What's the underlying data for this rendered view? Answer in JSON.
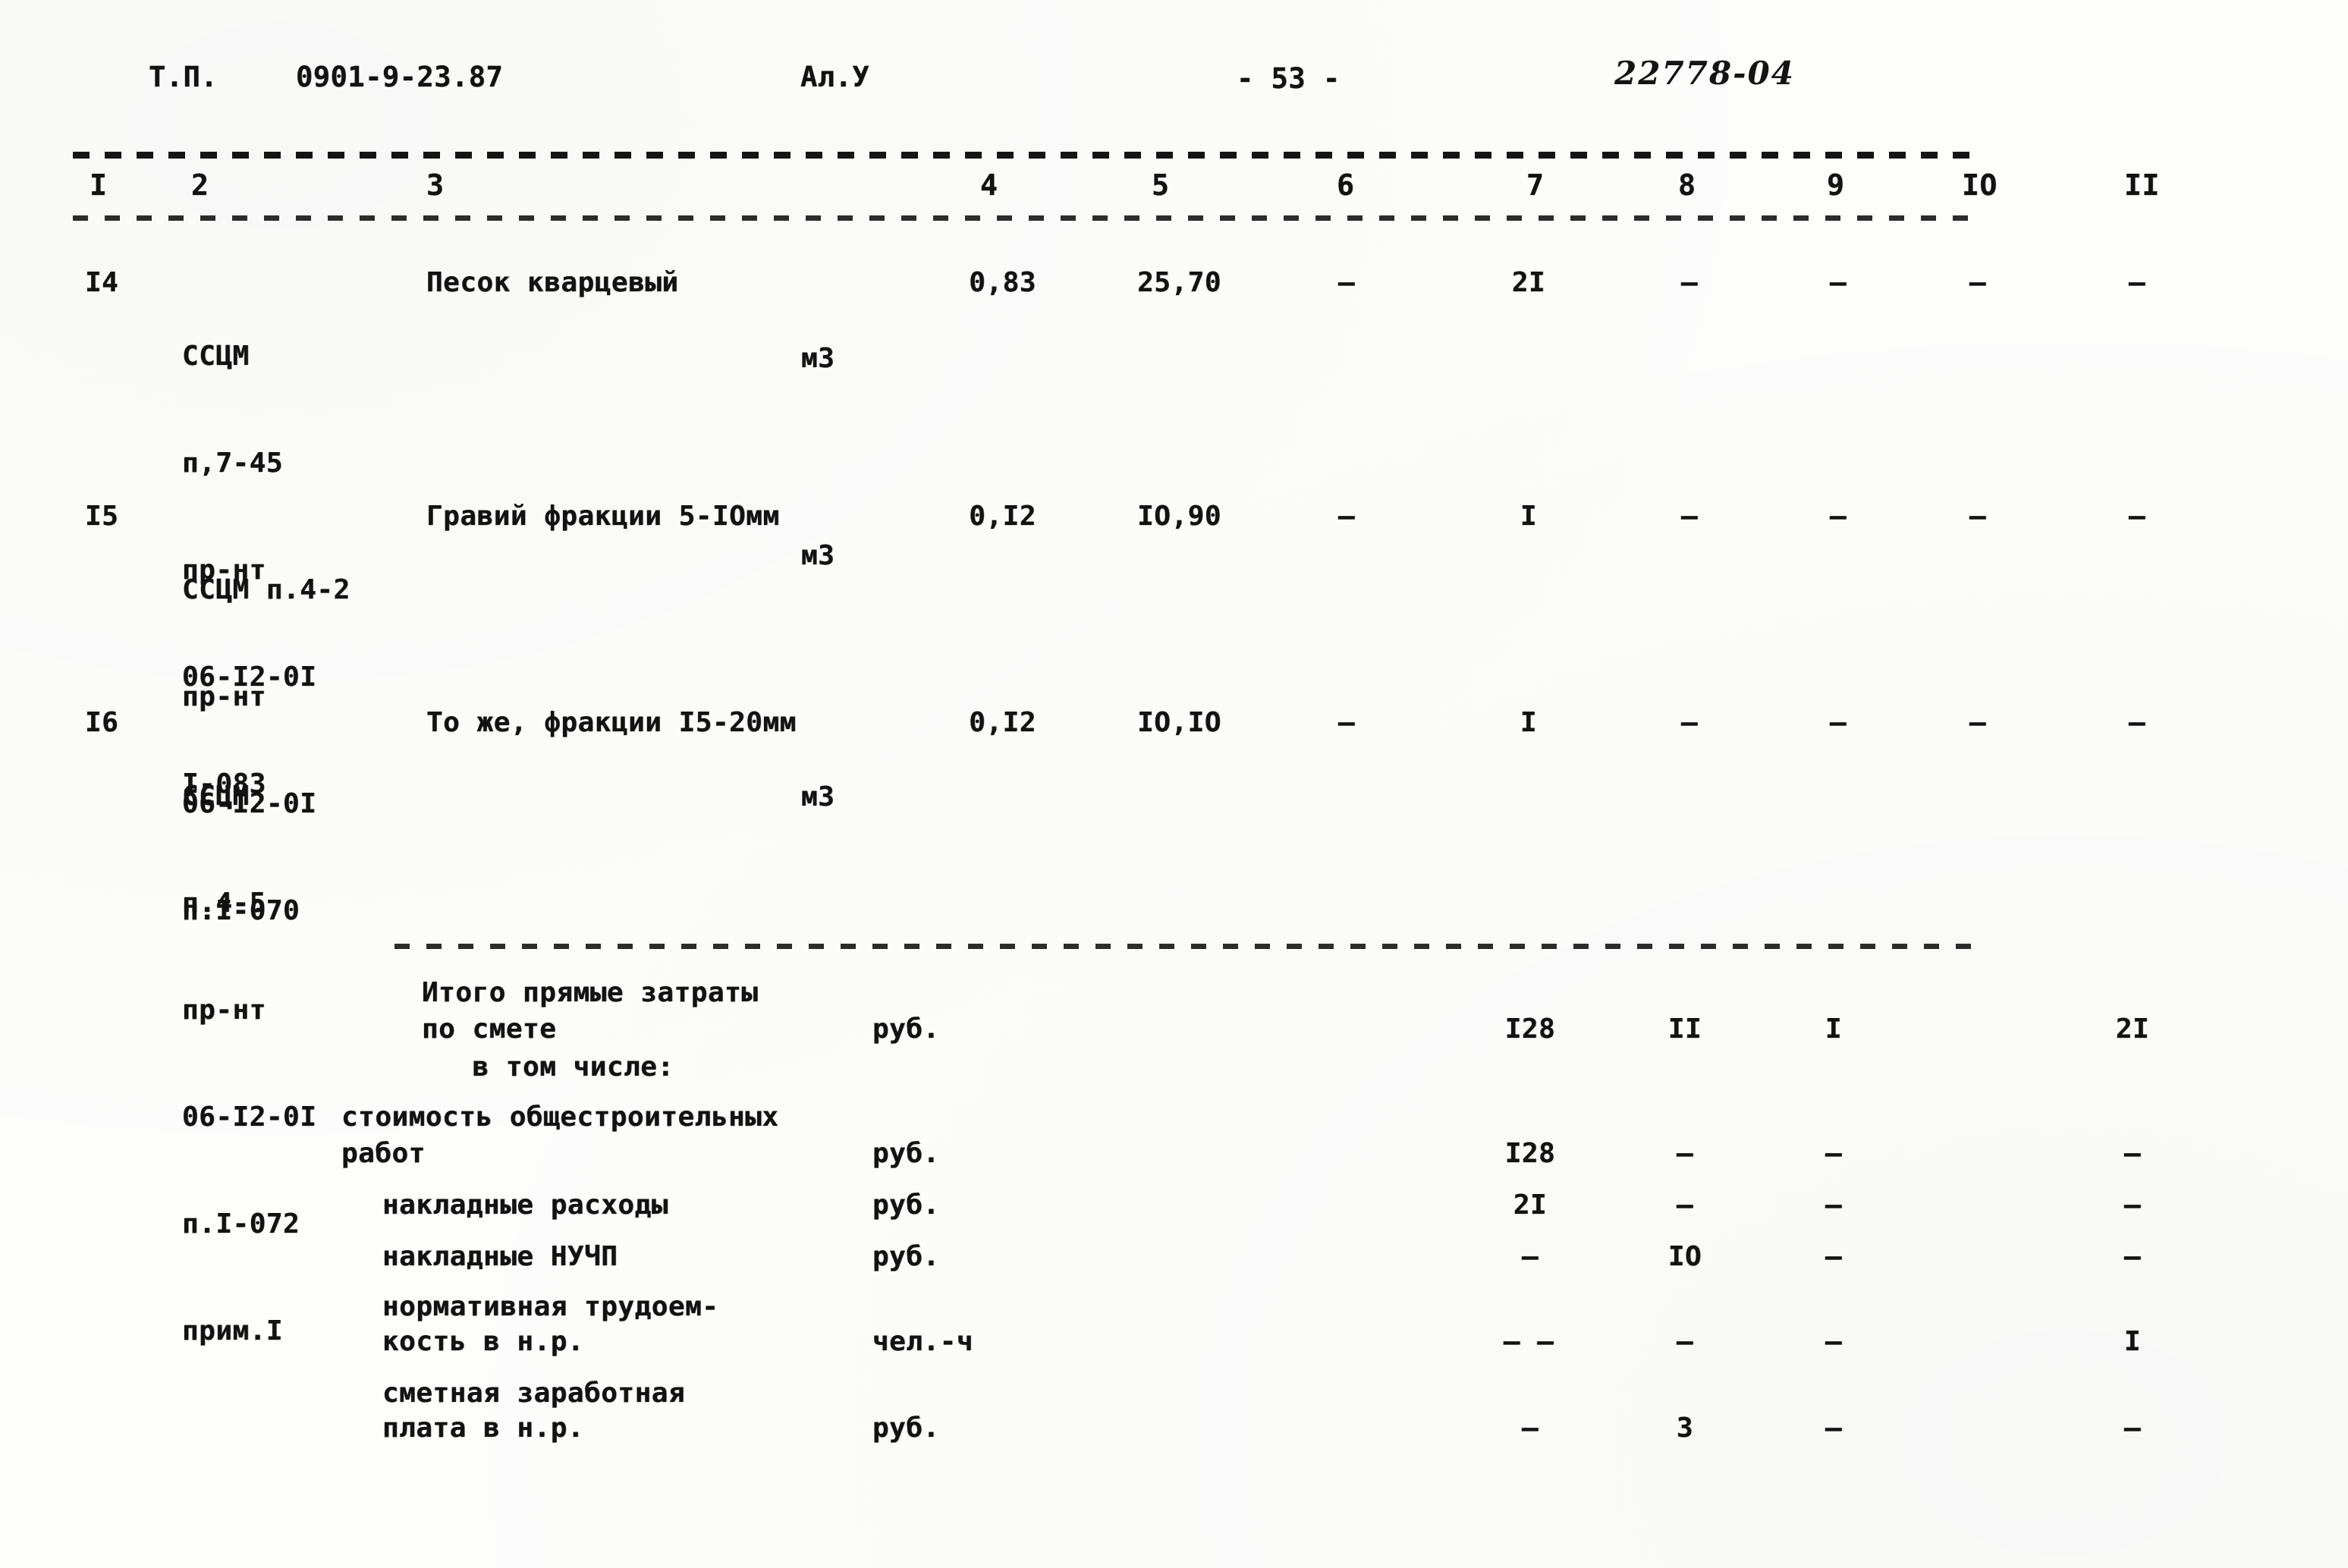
{
  "header": {
    "doc_type": "Т.П.",
    "doc_code": "0901-9-23.87",
    "album": "Ал.У",
    "page_number": "- 53 -",
    "stamp_code": "22778-04"
  },
  "column_headers": [
    "I",
    "2",
    "3",
    "4",
    "5",
    "6",
    "7",
    "8",
    "9",
    "IO",
    "II"
  ],
  "rows": [
    {
      "no": "I4",
      "code_lines": [
        "ССЦМ",
        "п,7-45",
        "пр-нт",
        "06-I2-0I",
        "I-083"
      ],
      "name": "Песок кварцевый",
      "unit": "м3",
      "c4": "0,83",
      "c5": "25,70",
      "c6": "–",
      "c7": "2I",
      "c8": "–",
      "c9": "–",
      "c10": "–",
      "c11": "–"
    },
    {
      "no": "I5",
      "code_lines": [
        "ССЦМ п.4-2",
        "пр-нт",
        "06-I2-0I",
        "п.I-070"
      ],
      "name": "Гравий фракции 5-IОмм",
      "unit": "м3",
      "c4": "0,I2",
      "c5": "IO,90",
      "c6": "–",
      "c7": "I",
      "c8": "–",
      "c9": "–",
      "c10": "–",
      "c11": "–"
    },
    {
      "no": "I6",
      "code_lines": [
        "ССЦМ",
        "п.4-5",
        "пр-нт",
        "06-I2-0I",
        "п.I-072",
        "прим.I"
      ],
      "name": "То же, фракции I5-20мм",
      "unit": "м3",
      "c4": "0,I2",
      "c5": "IO,IO",
      "c6": "–",
      "c7": "I",
      "c8": "–",
      "c9": "–",
      "c10": "–",
      "c11": "–"
    }
  ],
  "summary": [
    {
      "label_line1": "Итого прямые затраты",
      "label_line2": "по смете",
      "unit": "руб.",
      "c7": "I28",
      "c8": "II",
      "c9": "I",
      "c10": "",
      "c11": "2I"
    },
    {
      "label_line1": "",
      "label_line2": "   в том числе:",
      "unit": "",
      "c7": "",
      "c8": "",
      "c9": "",
      "c10": "",
      "c11": ""
    },
    {
      "label_line1": "стоимость общестроительных",
      "label_line2": "работ",
      "unit": "руб.",
      "c7": "I28",
      "c8": "–",
      "c9": "–",
      "c10": "",
      "c11": "–"
    },
    {
      "label_line1": "",
      "label_line2": "накладные расходы",
      "unit": "руб.",
      "c7": "2I",
      "c8": "–",
      "c9": "–",
      "c10": "",
      "c11": "–"
    },
    {
      "label_line1": "",
      "label_line2": "накладные НУЧП",
      "unit": "руб.",
      "c7": "–",
      "c8": "IO",
      "c9": "–",
      "c10": "",
      "c11": "–"
    },
    {
      "label_line1": "нормативная трудоем-",
      "label_line2": "кость в н.р.",
      "unit": "чел.-ч",
      "c7": "– –",
      "c8": "–",
      "c9": "–",
      "c10": "",
      "c11": "I"
    },
    {
      "label_line1": "сметная заработная",
      "label_line2": "плата в н.р.",
      "unit": "руб.",
      "c7": "–",
      "c8": "3",
      "c9": "–",
      "c10": "",
      "c11": "–"
    }
  ]
}
